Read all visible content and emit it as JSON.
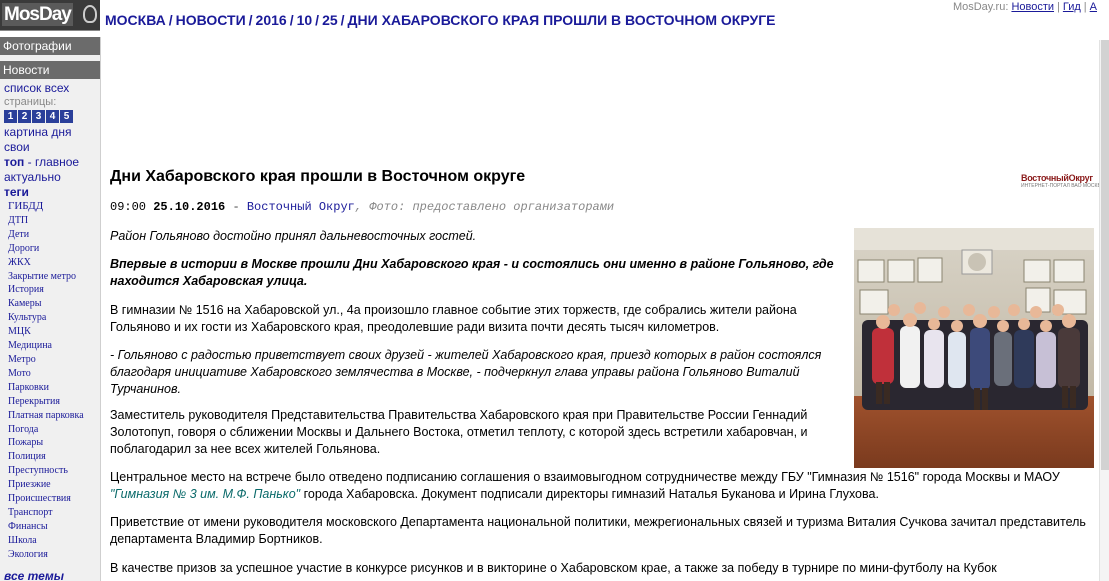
{
  "header": {
    "logo_text": "MosDay",
    "breadcrumb": [
      "МОСКВА",
      "НОВОСТИ",
      "2016",
      "10",
      "25",
      "ДНИ ХАБАРОВСКОГО КРАЯ ПРОШЛИ В ВОСТОЧНОМ ОКРУГЕ"
    ],
    "site_name": "MosDay.ru:",
    "links": [
      "Новости",
      "Гид",
      "А"
    ]
  },
  "sidebar": {
    "photos_label": "Фотографии",
    "news_label": "Новости",
    "list_all": "список всех",
    "pages_label": "страницы:",
    "pages": [
      "1",
      "2",
      "3",
      "4",
      "5"
    ],
    "day_picture": "картина дня",
    "own": "свои",
    "top_strong": "топ",
    "top_rest": " - главное",
    "actual": "актуально",
    "tags_title": "теги",
    "tags": [
      "ГИБДД",
      "ДТП",
      "Дети",
      "Дороги",
      "ЖКХ",
      "Закрытие метро",
      "История",
      "Камеры",
      "Культура",
      "МЦК",
      "Медицина",
      "Метро",
      "Мото",
      "Парковки",
      "Перекрытия",
      "Платная парковка",
      "Погода",
      "Пожары",
      "Полиция",
      "Преступность",
      "Приезжие",
      "Происшествия",
      "Транспорт",
      "Финансы",
      "Школа",
      "Экология"
    ],
    "more_topics": "все темы"
  },
  "article": {
    "title": "Дни Хабаровского края прошли в Восточном округе",
    "time": "09:00",
    "date": "25.10.2016",
    "dash": "-",
    "source": "Восточный Округ",
    "photo_credit": ", Фото: предоставлено организаторами",
    "source_logo": "ВосточныйОкруг",
    "source_logo_sub": "ИНТЕРНЕТ-ПОРТАЛ ВАО МОСКВЫ",
    "lead": "Район Гольяново достойно принял дальневосточных гостей.",
    "p1": "Впервые в истории в Москве прошли Дни Хабаровского края - и состоялись они именно в районе Гольяново, где находится Хабаровская улица.",
    "p2": "В гимназии № 1516 на Хабаровской ул., 4а произошло главное событие этих торжеств, где собрались жители района Гольяново и их гости из Хабаровского края, преодолевшие ради визита почти десять тысяч километров.",
    "p3": "- Гольяново с радостью приветствует своих друзей - жителей Хабаровского края, приезд которых в район состоялся благодаря инициативе Хабаровского землячества в Москве, - подчеркнул глава управы района Гольяново Виталий Турчанинов.",
    "p4": "Заместитель руководителя Представительства Правительства Хабаровского края при Правительстве России Геннадий Золотопуп, говоря о сближении Москвы и Дальнего Востока, отметил теплоту, с которой здесь встретили хабаровчан, и поблагодарил за нее всех жителей Гольянова.",
    "p5_a": "Центральное место на встрече было отведено подписанию соглашения о взаимовыгодном сотрудничестве между ГБУ \"Гимназия № 1516\" города Москвы и МАОУ ",
    "p5_link": "\"Гимназия № 3 им. М.Ф. Панько\"",
    "p5_b": " города Хабаровска. Документ подписали директоры гимназий Наталья Буканова и Ирина Глухова.",
    "p6": "Приветствие от имени руководителя московского Департамента национальной политики, межрегиональных связей и туризма Виталия Сучкова зачитал представитель департамента Владимир Бортников.",
    "p7": "В качестве призов за успешное участие в конкурсе рисунков и в викторине о Хабаровском крае, а также за победу в турнире по мини-футболу на Кубок"
  }
}
